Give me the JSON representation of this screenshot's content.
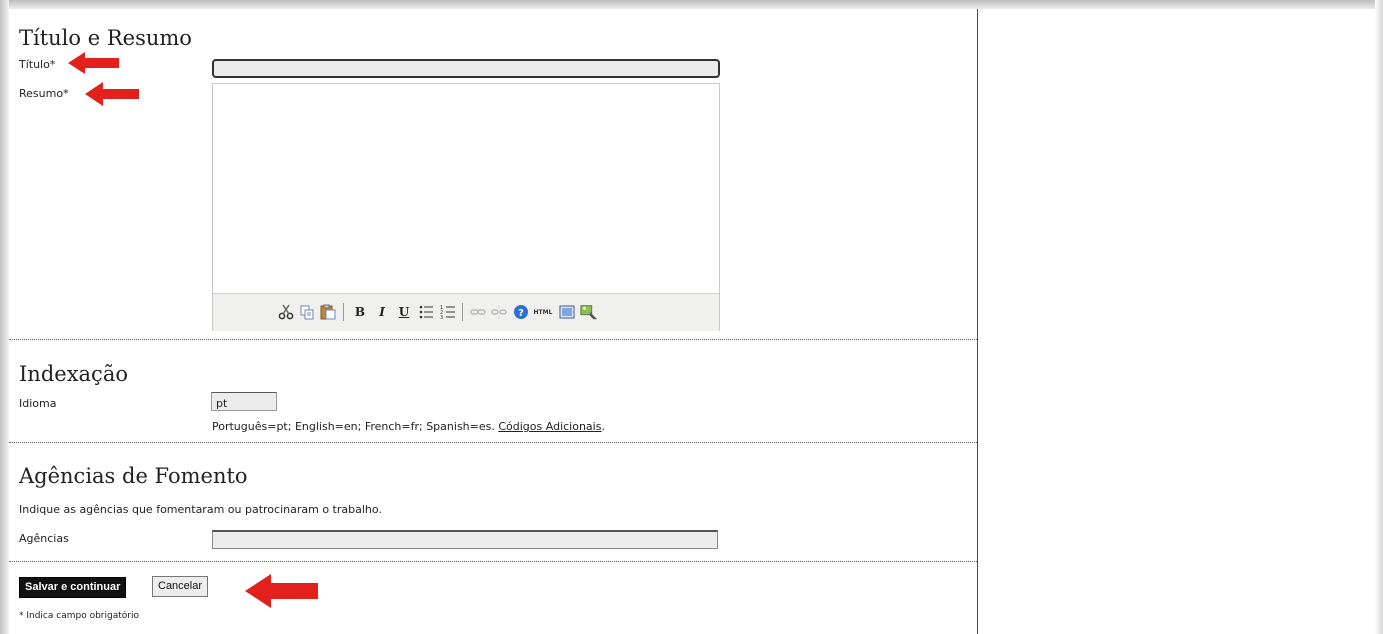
{
  "sections": {
    "titulo_resumo": {
      "heading": "Título e Resumo",
      "titulo_label": "Título*",
      "titulo_value": "",
      "resumo_label": "Resumo*"
    },
    "indexacao": {
      "heading": "Indexação",
      "idioma_label": "Idioma",
      "idioma_value": "pt",
      "hint": "Português=pt; English=en; French=fr; Spanish=es. ",
      "link": "Códigos Adicionais",
      "hint_end": "."
    },
    "agencias": {
      "heading": "Agências de Fomento",
      "instructions": "Indique as agências que fomentaram ou patrocinaram o trabalho.",
      "label": "Agências",
      "value": ""
    }
  },
  "editor_toolbar": {
    "icons": [
      "cut-icon",
      "copy-icon",
      "paste-icon",
      "bold-icon",
      "italic-icon",
      "underline-icon",
      "bullet-list-icon",
      "numbered-list-icon",
      "link-icon",
      "unlink-icon",
      "help-icon",
      "html-icon",
      "fullscreen-icon",
      "image-upload-icon"
    ],
    "bold_glyph": "B",
    "italic_glyph": "I",
    "underline_glyph": "U",
    "html_glyph": "HTML"
  },
  "buttons": {
    "save": "Salvar e continuar",
    "cancel": "Cancelar"
  },
  "footnote": "* Indica campo obrigatório",
  "colors": {
    "arrow": "#e3211c",
    "save_button": "#111111"
  }
}
